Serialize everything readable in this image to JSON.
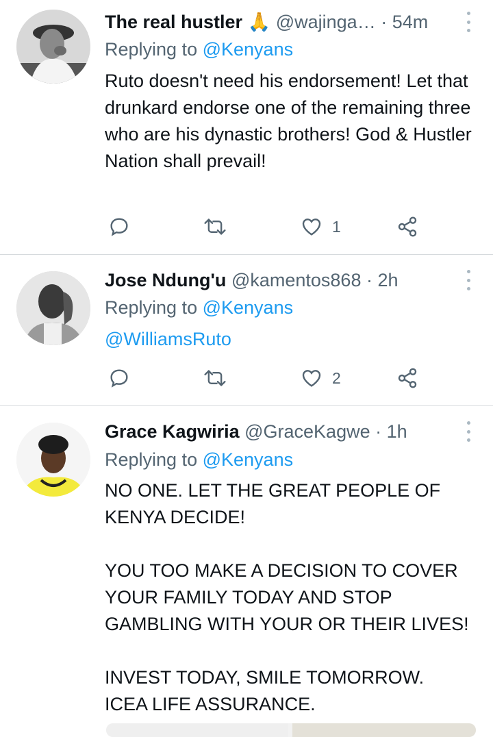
{
  "tweets": [
    {
      "name": "The real hustler",
      "emoji": "🙏",
      "handle": "@wajinga…",
      "time": "· 54m",
      "replying_prefix": "Replying to",
      "replying_to": "@Kenyans",
      "text": "Ruto doesn't need his endorsement! Let that drunkard endorse one of the remaining three who are his dynastic brothers! God & Hustler Nation shall prevail!",
      "likes": "1"
    },
    {
      "name": "Jose Ndung'u",
      "handle": "@kamentos868",
      "time": "· 2h",
      "replying_prefix": "Replying to",
      "replying_to": "@Kenyans",
      "text": "@WilliamsRuto",
      "likes": "2"
    },
    {
      "name": "Grace Kagwiria",
      "handle": "@GraceKagwe",
      "time": "· 1h",
      "replying_prefix": "Replying to",
      "replying_to": "@Kenyans",
      "text": "NO ONE. LET THE GREAT PEOPLE OF KENYA DECIDE!\n\nYOU TOO MAKE A DECISION TO COVER YOUR FAMILY TODAY AND STOP GAMBLING WITH YOUR OR THEIR LIVES!\n\nINVEST TODAY, SMILE TOMORROW.\nICEA LIFE ASSURANCE."
    }
  ],
  "icons": {
    "reply": "reply-icon",
    "retweet": "retweet-icon",
    "like": "heart-icon",
    "share": "share-icon",
    "more": "more-vertical-icon"
  },
  "colors": {
    "accent": "#1d9bf0",
    "secondary_text": "#536471",
    "divider": "#d6dadd"
  }
}
